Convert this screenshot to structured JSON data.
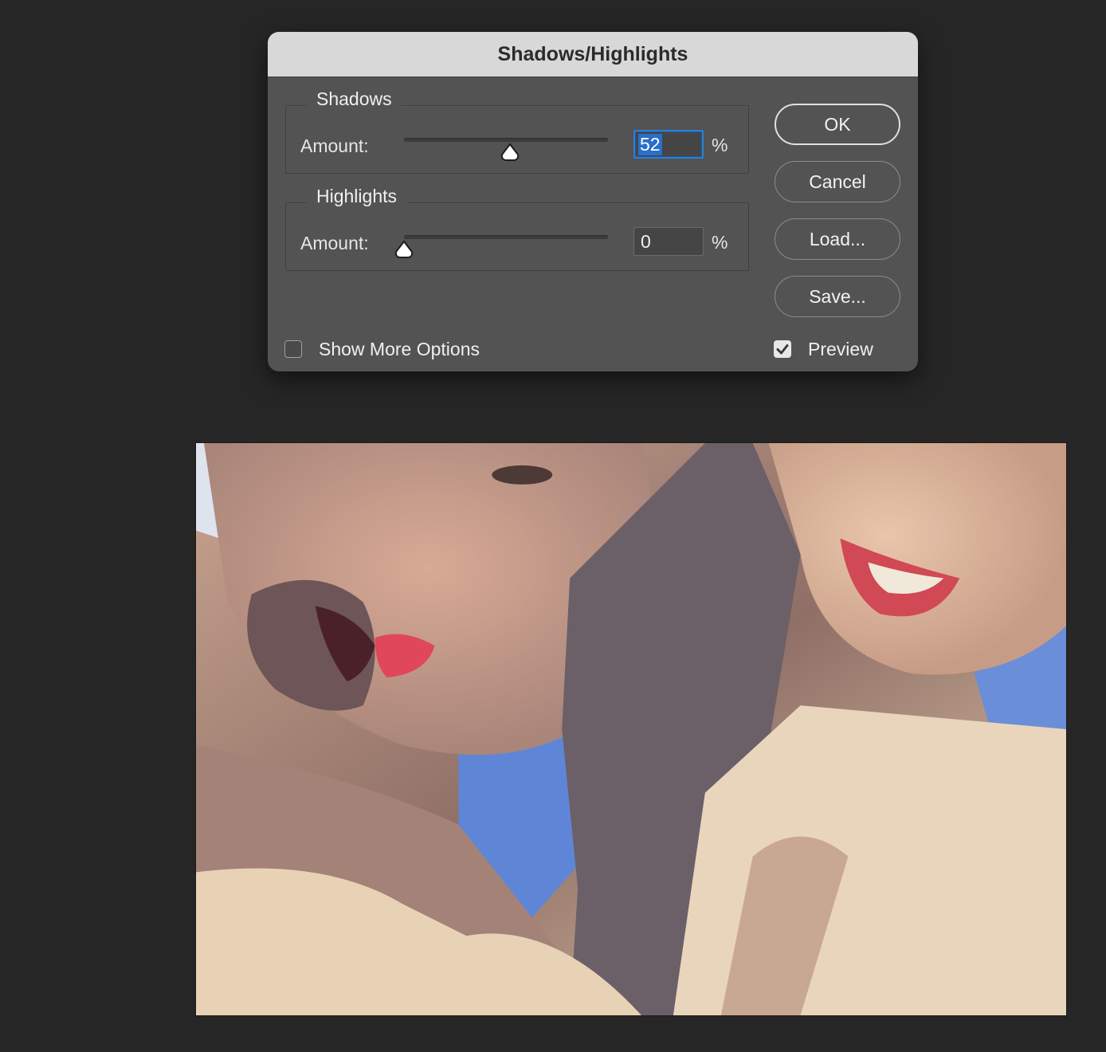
{
  "dialog": {
    "title": "Shadows/Highlights",
    "shadows": {
      "group_label": "Shadows",
      "amount_label": "Amount:",
      "amount_value": "52",
      "unit": "%",
      "slider_fraction": 0.52
    },
    "highlights": {
      "group_label": "Highlights",
      "amount_label": "Amount:",
      "amount_value": "0",
      "unit": "%",
      "slider_fraction": 0
    },
    "buttons": {
      "ok": "OK",
      "cancel": "Cancel",
      "load": "Load...",
      "save": "Save..."
    },
    "show_more_options": {
      "label": "Show More Options",
      "checked": false
    },
    "preview": {
      "label": "Preview",
      "checked": true
    }
  },
  "colors": {
    "canvas_background": "#262626",
    "dialog_body": "#535353",
    "titlebar": "#d8d8d8",
    "focus_accent": "#2c7fd6"
  }
}
